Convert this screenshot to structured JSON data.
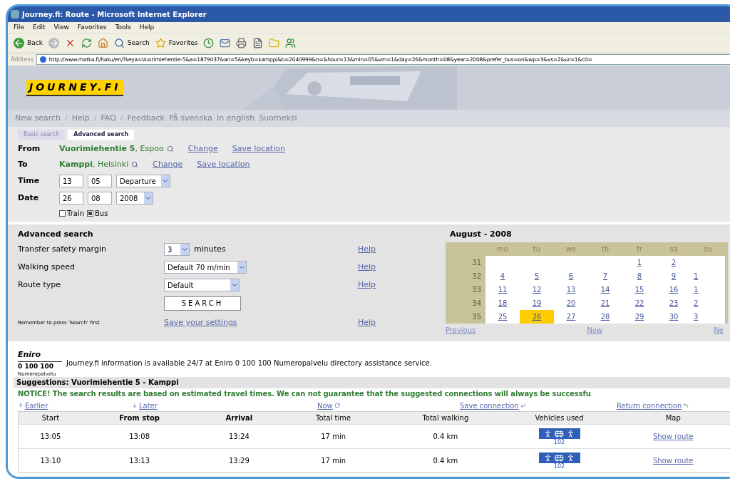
{
  "window": {
    "title": "Journey.fi: Route - Microsoft Internet Explorer"
  },
  "menu": [
    "File",
    "Edit",
    "View",
    "Favorites",
    "Tools",
    "Help"
  ],
  "toolbar": [
    {
      "kind": "back",
      "label": "Back"
    },
    {
      "kind": "forward"
    },
    {
      "kind": "stop"
    },
    {
      "kind": "refresh"
    },
    {
      "kind": "home"
    },
    {
      "kind": "search",
      "label": "Search"
    },
    {
      "kind": "favorites",
      "label": "Favorites"
    },
    {
      "kind": "history"
    },
    {
      "kind": "mail"
    },
    {
      "kind": "print"
    },
    {
      "kind": "edit"
    },
    {
      "kind": "folder"
    },
    {
      "kind": "messenger"
    }
  ],
  "address": {
    "label": "Address",
    "url": "http://www.matka.fi/haku/en/?keya=Vuorimiehentie-5&a=1879037&an=5&keyb=kamppi&b=2040999&n=&hour=13&min=05&vm=1&day=26&month=08&year=2008&prefer_bus=on&wp=3&vs=2&ur=1&c0="
  },
  "site": {
    "logo": "JOURNEY.FI",
    "nav": [
      {
        "text": "New search",
        "kind": "link"
      },
      {
        "text": "/",
        "kind": "separator"
      },
      {
        "text": "Help",
        "kind": "link"
      },
      {
        "text": "/",
        "kind": "separator"
      },
      {
        "text": "FAQ",
        "kind": "link"
      },
      {
        "text": "/",
        "kind": "separator"
      },
      {
        "text": "Feedback",
        "kind": "link"
      },
      {
        "text": "På svenska",
        "kind": "link"
      },
      {
        "text": "In english",
        "kind": "link"
      },
      {
        "text": "Suomeksi",
        "kind": "link"
      }
    ]
  },
  "tabs": [
    {
      "label": "Basic search",
      "selected": false
    },
    {
      "label": "Advanced search",
      "selected": true
    }
  ],
  "route": [
    {
      "label": "From",
      "place": "Vuorimiehentie 5",
      "city": ", Espoo",
      "links": [
        "Change",
        "Save location"
      ]
    },
    {
      "label": "To",
      "place": "Kamppi",
      "city": ", Helsinki",
      "links": [
        "Change",
        "Save location"
      ]
    }
  ],
  "time": {
    "label": "Time",
    "hour": "13",
    "minute": "05",
    "mode": "Departure"
  },
  "date": {
    "label": "Date",
    "day": "26",
    "month": "08",
    "year": "2008"
  },
  "modes": [
    {
      "label": "Train",
      "checked": false
    },
    {
      "label": "Bus",
      "checked": true
    }
  ],
  "advanced": {
    "title": "Advanced search",
    "rows": [
      {
        "label": "Transfer safety margin",
        "value": "3",
        "unit": "minutes",
        "help": "Help"
      },
      {
        "label": "Walking speed",
        "value": "Default 70 m/min",
        "help": "Help"
      },
      {
        "label": "Route type",
        "value": "Default",
        "help": "Help"
      }
    ],
    "search_button": "SEARCH",
    "reminder": "Remember to press 'Search' first",
    "save_link": "Save your settings",
    "help": "Help"
  },
  "calendar": {
    "title": "August - 2008",
    "weekdays": [
      "mo",
      "tu",
      "we",
      "th",
      "fr",
      "sa",
      "su"
    ],
    "weeks": [
      {
        "number": "31",
        "days": [
          {
            "kind": "blank"
          },
          {
            "kind": "blank"
          },
          {
            "kind": "blank"
          },
          {
            "kind": "blank"
          },
          {
            "kind": "day",
            "d": "1",
            "selected": false
          },
          {
            "kind": "day",
            "d": "2",
            "selected": false
          },
          {
            "kind": "blank"
          }
        ]
      },
      {
        "number": "32",
        "days": [
          {
            "d": "4",
            "selected": false
          },
          {
            "d": "5",
            "selected": false
          },
          {
            "d": "6",
            "selected": false
          },
          {
            "d": "7",
            "selected": false
          },
          {
            "d": "8",
            "selected": false
          },
          {
            "d": "9",
            "selected": false
          },
          {
            "d": "1",
            "selected": false
          }
        ]
      },
      {
        "number": "33",
        "days": [
          {
            "d": "11",
            "selected": false
          },
          {
            "d": "12",
            "selected": false
          },
          {
            "d": "13",
            "selected": false
          },
          {
            "d": "14",
            "selected": false
          },
          {
            "d": "15",
            "selected": false
          },
          {
            "d": "16",
            "selected": false
          },
          {
            "d": "1",
            "selected": false
          }
        ]
      },
      {
        "number": "34",
        "days": [
          {
            "d": "18",
            "selected": false
          },
          {
            "d": "19",
            "selected": false
          },
          {
            "d": "20",
            "selected": false
          },
          {
            "d": "21",
            "selected": false
          },
          {
            "d": "22",
            "selected": false
          },
          {
            "d": "23",
            "selected": false
          },
          {
            "d": "2",
            "selected": false
          }
        ]
      },
      {
        "number": "35",
        "days": [
          {
            "d": "25",
            "selected": false
          },
          {
            "d": "26",
            "selected": true
          },
          {
            "d": "27",
            "selected": false
          },
          {
            "d": "28",
            "selected": false
          },
          {
            "d": "29",
            "selected": false
          },
          {
            "d": "30",
            "selected": false
          },
          {
            "d": "3",
            "selected": false
          }
        ]
      }
    ],
    "nav": [
      "Previous",
      "Now",
      "Ne"
    ]
  },
  "eniro": {
    "logo": "Eniro",
    "number": "0 100 100",
    "caption": "Numeropalvelu",
    "text": "Journey.fi information is available 24/7 at Eniro 0 100 100 Numeropalvelu directory assistance service."
  },
  "results": {
    "title": "Suggestions: Vuorimiehentie 5 - Kamppi",
    "notice": "NOTICE! The search results are based on estimated travel times. We can not guarantee that the suggested connections will always be successfu",
    "links": [
      {
        "label": "Earlier",
        "kind": "up"
      },
      {
        "label": "Later",
        "kind": "down"
      },
      {
        "label": "Now",
        "kind": "refresh"
      },
      {
        "label": "Save connection",
        "kind": "save"
      },
      {
        "label": "Return connection",
        "kind": "return"
      }
    ],
    "columns": [
      {
        "label": "Start",
        "bold": false
      },
      {
        "label": "From stop",
        "bold": true
      },
      {
        "label": "Arrival",
        "bold": true
      },
      {
        "label": "Total time",
        "bold": false
      },
      {
        "label": "Total walking",
        "bold": false
      },
      {
        "label": "Vehicles used",
        "bold": false
      },
      {
        "label": "Map",
        "bold": false
      }
    ],
    "rows": [
      {
        "start": "13:05",
        "from_stop": "13:08",
        "arrival": "13:24",
        "total_time": "17 min",
        "walking": "0.4 km",
        "vehicle": "102",
        "map": "Show route"
      },
      {
        "start": "13:10",
        "from_stop": "13:13",
        "arrival": "13:29",
        "total_time": "17 min",
        "walking": "0.4 km",
        "vehicle": "102",
        "map": "Show route"
      }
    ]
  }
}
